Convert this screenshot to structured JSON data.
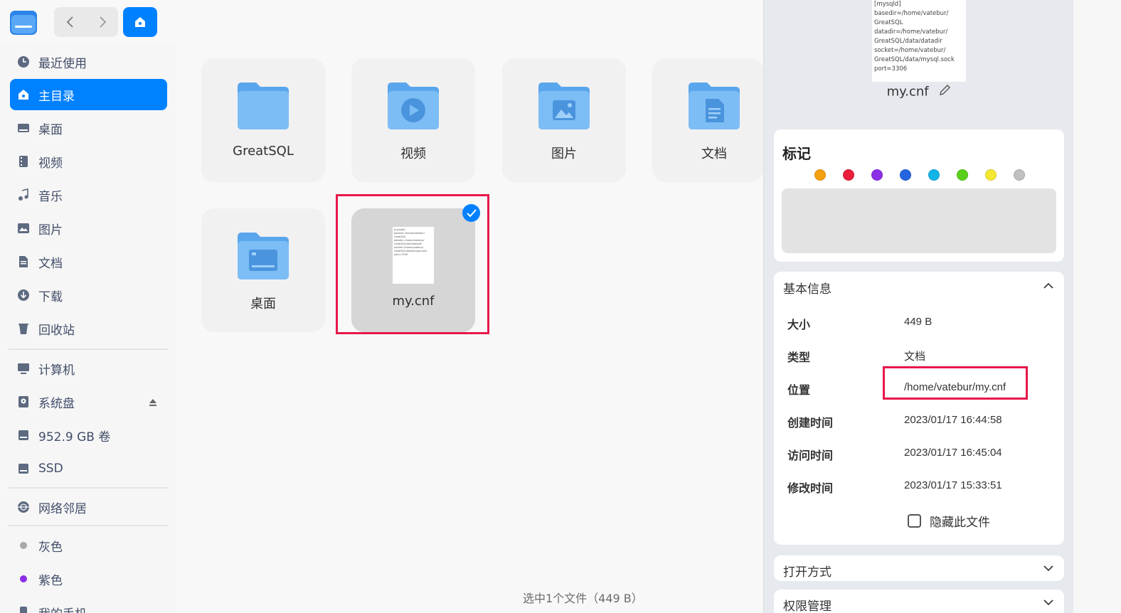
{
  "toolbar": {
    "back_icon": "chevron-left-icon",
    "forward_icon": "chevron-right-icon",
    "home_icon": "home-icon",
    "close_icon": "close-icon"
  },
  "sidebar": {
    "items": [
      {
        "label": "最近使用",
        "icon": "clock-icon"
      },
      {
        "label": "主目录",
        "icon": "home-icon",
        "active": true
      },
      {
        "label": "桌面",
        "icon": "desktop-icon"
      },
      {
        "label": "视频",
        "icon": "film-icon"
      },
      {
        "label": "音乐",
        "icon": "music-icon"
      },
      {
        "label": "图片",
        "icon": "image-icon"
      },
      {
        "label": "文档",
        "icon": "document-icon"
      },
      {
        "label": "下载",
        "icon": "download-icon"
      },
      {
        "label": "回收站",
        "icon": "trash-icon"
      },
      {
        "label": "计算机",
        "icon": "computer-icon"
      },
      {
        "label": "系统盘",
        "icon": "disk-icon"
      },
      {
        "label": "952.9 GB 卷",
        "icon": "drive-icon"
      },
      {
        "label": "SSD",
        "icon": "drive-icon"
      },
      {
        "label": "网络邻居",
        "icon": "network-icon"
      },
      {
        "label": "灰色",
        "icon": "gray-tag-icon",
        "color": "#a8a8a8"
      },
      {
        "label": "紫色",
        "icon": "purple-tag-icon",
        "color": "#8c2ee6"
      },
      {
        "label": "我的手机",
        "icon": "phone-icon"
      }
    ]
  },
  "files": [
    {
      "name": "GreatSQL",
      "type": "folder"
    },
    {
      "name": "视频",
      "type": "folder-video"
    },
    {
      "name": "图片",
      "type": "folder-image"
    },
    {
      "name": "文档",
      "type": "folder-doc"
    },
    {
      "name": "桌面",
      "type": "folder-desktop"
    },
    {
      "name": "my.cnf",
      "type": "file",
      "selected": true
    }
  ],
  "status_bar": "选中1个文件（449 B）",
  "panel": {
    "preview_lines": [
      "[mysqld]",
      "basedir=/home/vatebur/",
      "GreatSQL",
      "datadir=/home/vatebur/",
      "GreatSQL/data/datadir",
      "socket=/home/vatebur/",
      "GreatSQL/data/mysql.sock",
      "port=3306"
    ],
    "filename": "my.cnf",
    "tags_title": "标记",
    "tag_colors": [
      "#f5a00f",
      "#ea1f3c",
      "#8c2ee6",
      "#2464e0",
      "#12b4e8",
      "#5ad01c",
      "#f5e832",
      "#c0c0c0"
    ],
    "basic_info_title": "基本信息",
    "info": [
      {
        "label": "大小",
        "value": "449 B"
      },
      {
        "label": "类型",
        "value": "文档"
      },
      {
        "label": "位置",
        "value": "/home/vatebur/my.cnf"
      },
      {
        "label": "创建时间",
        "value": "2023/01/17 16:44:58"
      },
      {
        "label": "访问时间",
        "value": "2023/01/17 16:45:04"
      },
      {
        "label": "修改时间",
        "value": "2023/01/17 15:33:51"
      }
    ],
    "hide_file_label": "隐藏此文件",
    "open_with_title": "打开方式",
    "permissions_title": "权限管理"
  },
  "colors": {
    "accent": "#0081ff",
    "highlight": "#e8174b"
  }
}
